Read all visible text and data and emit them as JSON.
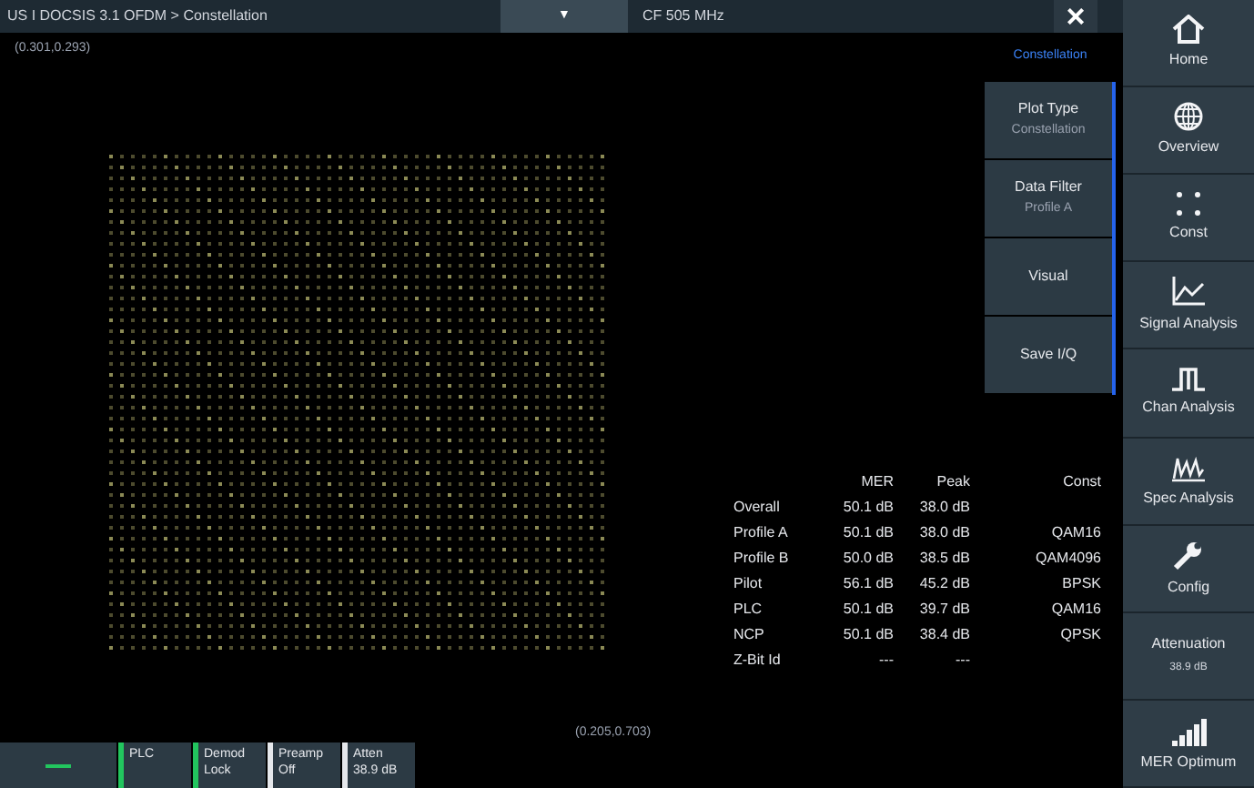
{
  "title_bar": {
    "breadcrumb": "US I DOCSIS 3.1 OFDM > Constellation",
    "dropdown_caret": "▼",
    "frequency": "CF 505 MHz"
  },
  "close_icon": "×",
  "cursor_top": "(0.301,0.293)",
  "cursor_bottom": "(0.205,0.703)",
  "softkey_panel": {
    "title": "Constellation",
    "items": [
      {
        "label": "Plot Type",
        "value": "Constellation"
      },
      {
        "label": "Data Filter",
        "value": "Profile A"
      },
      {
        "label": "Visual"
      },
      {
        "label": "Save I/Q"
      }
    ]
  },
  "nav": [
    {
      "kind": "home",
      "label": "Home"
    },
    {
      "kind": "globe",
      "label": "Overview"
    },
    {
      "kind": "dots",
      "label": "Const"
    },
    {
      "kind": "graph",
      "label": "Signal Analysis"
    },
    {
      "kind": "pulse",
      "label": "Chan Analysis"
    },
    {
      "kind": "spectrum",
      "label": "Spec Analysis"
    },
    {
      "kind": "wrench",
      "label": "Config"
    },
    {
      "kind": "text",
      "label": "Attenuation",
      "value": "38.9 dB"
    },
    {
      "kind": "bars",
      "label": "MER Optimum"
    }
  ],
  "table": {
    "columns": [
      "",
      "MER",
      "Peak",
      "Const"
    ],
    "rows": [
      [
        "Overall",
        "50.1 dB",
        "38.0 dB",
        ""
      ],
      [
        "Profile A",
        "50.1 dB",
        "38.0 dB",
        "QAM16"
      ],
      [
        "Profile B",
        "50.0 dB",
        "38.5 dB",
        "QAM4096"
      ],
      [
        "Pilot",
        "56.1 dB",
        "45.2 dB",
        "BPSK"
      ],
      [
        "PLC",
        "50.1 dB",
        "39.7 dB",
        "QAM16"
      ],
      [
        "NCP",
        "50.1 dB",
        "38.4 dB",
        "QPSK"
      ],
      [
        "Z-Bit Id",
        "---",
        "---",
        ""
      ]
    ]
  },
  "status_bar": [
    {
      "color": "#22c55e"
    },
    {
      "lines": [
        "PLC"
      ],
      "color": "#22c55e"
    },
    {
      "lines": [
        "Demod",
        "Lock"
      ],
      "color": "#22c55e"
    },
    {
      "lines": [
        "Preamp",
        "Off"
      ],
      "color": "#e5e7eb"
    },
    {
      "lines": [
        "Atten",
        "38.9 dB"
      ],
      "color": "#e5e7eb"
    }
  ]
}
